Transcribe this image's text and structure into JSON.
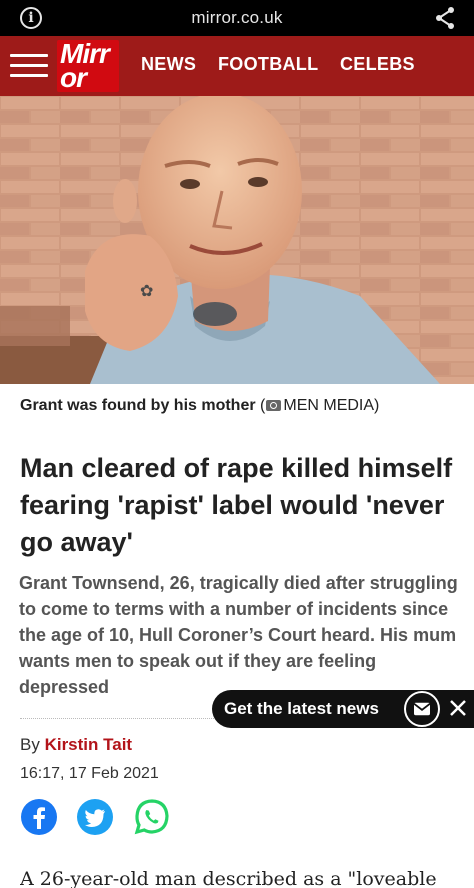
{
  "browser": {
    "url": "mirror.co.uk",
    "icons": {
      "info": "info-icon",
      "share": "share-icon"
    }
  },
  "header": {
    "logo_line1": "Mirr",
    "logo_line2": "or",
    "nav": [
      "NEWS",
      "FOOTBALL",
      "CELEBS"
    ],
    "colors": {
      "bar": "#9e1b19",
      "logo": "#d10a11"
    }
  },
  "hero": {
    "caption_text": "Grant was found by his mother",
    "caption_credit": "MEN MEDIA",
    "caption_open": " (",
    "caption_close": ")"
  },
  "article": {
    "headline": "Man cleared of rape killed himself fearing 'rapist' label would 'never go away'",
    "standfirst": "Grant Townsend, 26, tragically died after struggling to come to terms with a number of incidents since the age of 10, Hull Coroner’s Court heard. His mum wants men to speak out if they are feeling depressed",
    "byline_prefix": "By ",
    "author": "Kirstin Tait",
    "date": "16:17, 17 Feb 2021",
    "body_start": "A 26-year-old man described as a \"loveable"
  },
  "newsletter": {
    "label": "Get the latest news"
  },
  "social": [
    "facebook-icon",
    "twitter-icon",
    "whatsapp-icon"
  ]
}
